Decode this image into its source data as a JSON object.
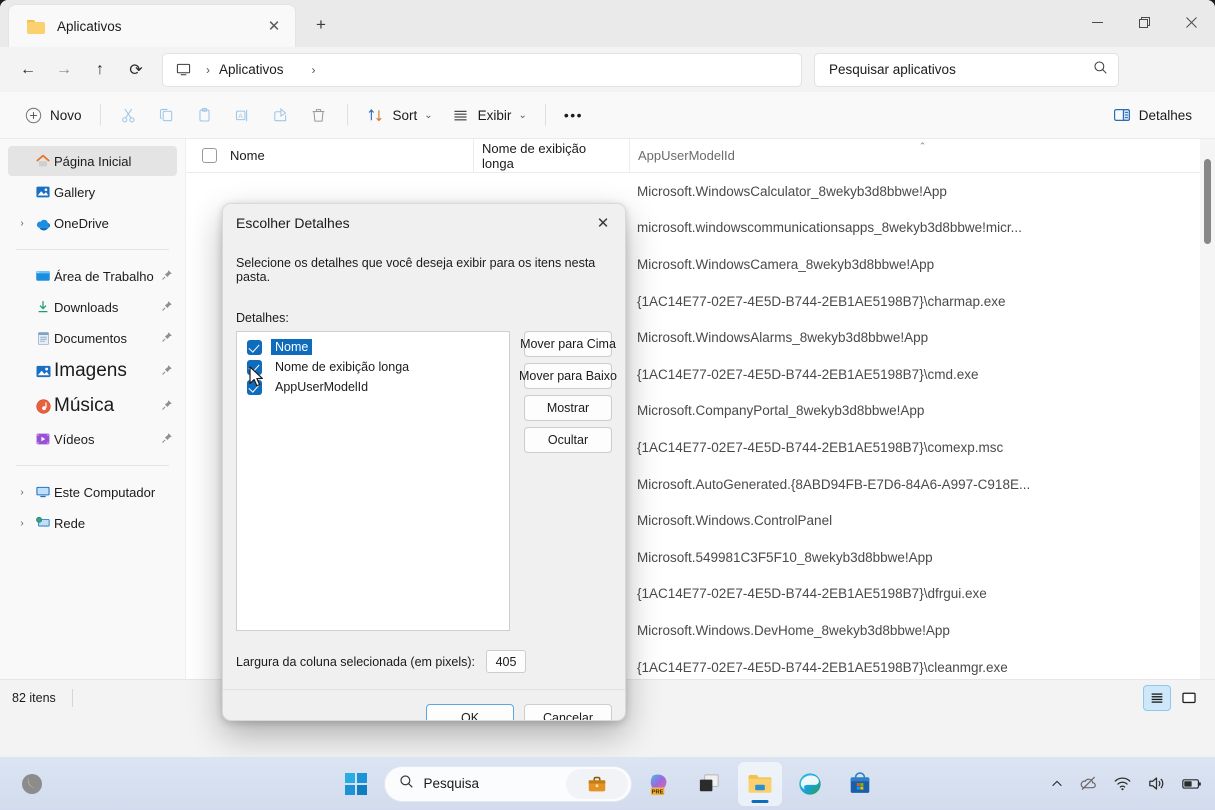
{
  "window": {
    "tab_title": "Aplicativos",
    "tab_close_glyph": "✕",
    "new_tab_glyph": "+",
    "minimize_glyph": "—",
    "maximize_glyph": "❐",
    "close_glyph": "✕"
  },
  "address": {
    "back_glyph": "←",
    "forward_glyph": "→",
    "up_glyph": "↑",
    "refresh_glyph": "⟳",
    "crumb_root_icon": "monitor-icon",
    "separator": "›",
    "crumb": "Aplicativos",
    "trailing_separator": "›"
  },
  "search": {
    "placeholder": "Pesquisar aplicativos",
    "value": "",
    "icon": "search-icon"
  },
  "toolbar": {
    "new_label": "Novo",
    "new_icon": "plus-circle-icon",
    "cut_icon": "scissors-icon",
    "copy_icon": "copy-icon",
    "paste_icon": "clipboard-icon",
    "rename_icon": "rename-icon",
    "share_icon": "share-icon",
    "delete_icon": "trash-icon",
    "sort_label": "Sort",
    "sort_icon": "sort-arrows-icon",
    "view_label": "Exibir",
    "view_icon": "list-lines-icon",
    "more_label": "•••",
    "details_label": "Detalhes",
    "details_icon": "details-pane-icon",
    "chevron": "⌄"
  },
  "sidebar": {
    "items": [
      {
        "label": "Página Inicial",
        "icon": "home-icon",
        "selected": true,
        "expander": false,
        "pinned": false,
        "big": false
      },
      {
        "label": "Gallery",
        "icon": "gallery-icon",
        "selected": false,
        "expander": false,
        "pinned": false,
        "big": false
      },
      {
        "label": "OneDrive",
        "icon": "onedrive-icon",
        "selected": false,
        "expander": true,
        "pinned": false,
        "big": false
      },
      {
        "separator": true
      },
      {
        "label": "Área de Trabalho",
        "icon": "desktop-icon",
        "selected": false,
        "expander": false,
        "pinned": true,
        "big": false
      },
      {
        "label": "Downloads",
        "icon": "download-icon",
        "selected": false,
        "expander": false,
        "pinned": true,
        "big": false
      },
      {
        "label": "Documentos",
        "icon": "document-icon",
        "selected": false,
        "expander": false,
        "pinned": true,
        "big": false
      },
      {
        "label": "Imagens",
        "icon": "pictures-icon",
        "selected": false,
        "expander": false,
        "pinned": true,
        "big": true
      },
      {
        "label": "Música",
        "icon": "music-icon",
        "selected": false,
        "expander": false,
        "pinned": true,
        "big": true
      },
      {
        "label": "Vídeos",
        "icon": "video-icon",
        "selected": false,
        "expander": false,
        "pinned": true,
        "big": false
      },
      {
        "separator": true
      },
      {
        "label": "Este Computador",
        "icon": "pc-icon",
        "selected": false,
        "expander": true,
        "pinned": false,
        "big": false
      },
      {
        "label": "Rede",
        "icon": "network-icon",
        "selected": false,
        "expander": true,
        "pinned": false,
        "big": false
      }
    ]
  },
  "filelist": {
    "columns": [
      {
        "label": "Nome",
        "sorted": false
      },
      {
        "label": "Nome de exibição longa",
        "sorted": false
      },
      {
        "label": "AppUserModelId",
        "sorted": true,
        "sort_glyph": "⌃"
      }
    ],
    "select_all_checkbox": false,
    "rows": [
      {
        "name": "",
        "display_name": "",
        "app_user_model_id": "Microsoft.WindowsCalculator_8wekyb3d8bbwe!App"
      },
      {
        "name": "",
        "display_name": "",
        "app_user_model_id": "microsoft.windowscommunicationsapps_8wekyb3d8bbwe!micr..."
      },
      {
        "name": "",
        "display_name": "",
        "app_user_model_id": "Microsoft.WindowsCamera_8wekyb3d8bbwe!App"
      },
      {
        "name": "",
        "display_name": "",
        "app_user_model_id": "{1AC14E77-02E7-4E5D-B744-2EB1AE5198B7}\\charmap.exe"
      },
      {
        "name": "",
        "display_name": "",
        "app_user_model_id": "Microsoft.WindowsAlarms_8wekyb3d8bbwe!App"
      },
      {
        "name": "",
        "display_name": "",
        "app_user_model_id": "{1AC14E77-02E7-4E5D-B744-2EB1AE5198B7}\\cmd.exe"
      },
      {
        "name": "",
        "display_name": "",
        "app_user_model_id": "Microsoft.CompanyPortal_8wekyb3d8bbwe!App"
      },
      {
        "name": "",
        "display_name": "",
        "app_user_model_id": "{1AC14E77-02E7-4E5D-B744-2EB1AE5198B7}\\comexp.msc"
      },
      {
        "name": "",
        "display_name": "",
        "app_user_model_id": "Microsoft.AutoGenerated.{8ABD94FB-E7D6-84A6-A997-C918E..."
      },
      {
        "name": "",
        "display_name": "",
        "app_user_model_id": "Microsoft.Windows.ControlPanel"
      },
      {
        "name": "",
        "display_name": "",
        "app_user_model_id": "Microsoft.549981C3F5F10_8wekyb3d8bbwe!App"
      },
      {
        "name": "",
        "display_name": "",
        "app_user_model_id": "{1AC14E77-02E7-4E5D-B744-2EB1AE5198B7}\\dfrgui.exe"
      },
      {
        "name": "",
        "display_name": "",
        "app_user_model_id": "Microsoft.Windows.DevHome_8wekyb3d8bbwe!App"
      },
      {
        "name": "",
        "display_name": "",
        "app_user_model_id": "{1AC14E77-02E7-4E5D-B744-2EB1AE5198B7}\\cleanmgr.exe"
      }
    ]
  },
  "status": {
    "item_count": "82 itens",
    "details_view_icon": "details-view-icon",
    "large_icons_view_icon": "large-icons-view-icon"
  },
  "dialog": {
    "title": "Escolher Detalhes",
    "close_glyph": "✕",
    "description": "Selecione os detalhes que você deseja exibir para os itens nesta pasta.",
    "details_label": "Detalhes:",
    "details": [
      {
        "label": "Nome",
        "checked": true,
        "selected": true
      },
      {
        "label": "Nome de exibição longa",
        "checked": true,
        "selected": false
      },
      {
        "label": "AppUserModelId",
        "checked": true,
        "selected": false
      }
    ],
    "side_buttons": [
      {
        "label": "Mover para Cima"
      },
      {
        "label": "Mover para Baixo"
      },
      {
        "label": "Mostrar"
      },
      {
        "label": "Ocultar"
      }
    ],
    "width_label": "Largura da coluna selecionada (em pixels):",
    "width_value": "405",
    "ok_label": "OK",
    "cancel_label": "Cancelar"
  },
  "taskbar": {
    "start_icon": "windows-start-icon",
    "search_placeholder": "Pesquisa",
    "search_icon": "search-icon",
    "briefcase_icon": "briefcase-icon",
    "apps": [
      {
        "name": "copilot-icon",
        "active": false
      },
      {
        "name": "task-view-icon",
        "active": false
      },
      {
        "name": "file-explorer-icon",
        "active": true
      },
      {
        "name": "edge-icon",
        "active": false
      },
      {
        "name": "microsoft-store-icon",
        "active": false
      }
    ],
    "tray": [
      {
        "name": "show-hidden-icons-icon",
        "glyph": "⌃"
      },
      {
        "name": "onedrive-offline-icon",
        "glyph": ""
      },
      {
        "name": "wifi-icon",
        "glyph": ""
      },
      {
        "name": "volume-icon",
        "glyph": ""
      },
      {
        "name": "battery-icon",
        "glyph": ""
      }
    ]
  },
  "colors": {
    "accent": "#0f6cbd",
    "selection": "#0f6cbd",
    "taskbar": "#dbe4f2"
  }
}
